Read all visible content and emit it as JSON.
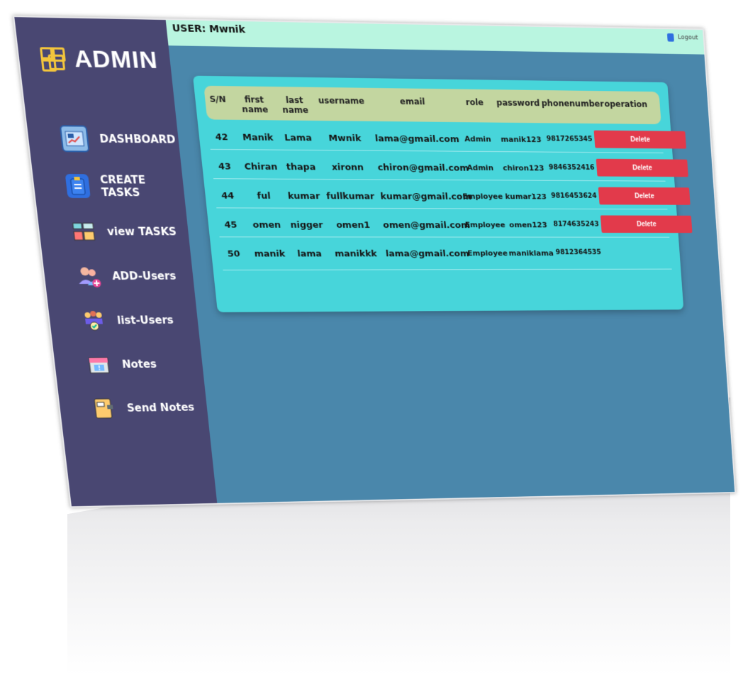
{
  "brand": {
    "title": "ADMIN",
    "accent": "#f3c53c"
  },
  "sidebar": {
    "items": [
      {
        "label": "DASHBOARD",
        "icon": "dashboard-icon"
      },
      {
        "label": "CREATE TASKS",
        "icon": "clipboard-icon"
      },
      {
        "label": "view TASKS",
        "icon": "task-list-icon"
      },
      {
        "label": "ADD-Users",
        "icon": "add-user-icon"
      },
      {
        "label": "list-Users",
        "icon": "users-group-icon"
      },
      {
        "label": "Notes",
        "icon": "calendar-icon"
      },
      {
        "label": "Send Notes",
        "icon": "notebook-icon"
      }
    ]
  },
  "topbar": {
    "user_label": "USER: Mwnik",
    "logout_label": "Logout"
  },
  "table": {
    "columns": [
      "S/N",
      "first name",
      "last name",
      "username",
      "email",
      "role",
      "password",
      "phonenumber",
      "operation"
    ],
    "delete_label": "Delete",
    "rows": [
      {
        "sn": "42",
        "first": "Manik",
        "last": "Lama",
        "username": "Mwnik",
        "email": "lama@gmail.com",
        "role": "Admin",
        "password": "manik123",
        "phone": "9817265345"
      },
      {
        "sn": "43",
        "first": "Chiran",
        "last": "thapa",
        "username": "xironn",
        "email": "chiron@gmail.com",
        "role": "Admin",
        "password": "chiron123",
        "phone": "9846352416"
      },
      {
        "sn": "44",
        "first": "ful",
        "last": "kumar",
        "username": "fullkumar",
        "email": "kumar@gmail.com",
        "role": "Employee",
        "password": "kumar123",
        "phone": "9816453624"
      },
      {
        "sn": "45",
        "first": "omen",
        "last": "nigger",
        "username": "omen1",
        "email": "omen@gmail.com",
        "role": "Employee",
        "password": "omen123",
        "phone": "8174635243"
      },
      {
        "sn": "50",
        "first": "manik",
        "last": "lama",
        "username": "manikkk",
        "email": "lama@gmail.com",
        "role": "Employee",
        "password": "maniklama",
        "phone": "9812364535"
      }
    ]
  },
  "colors": {
    "sidebar": "#494772",
    "topbar": "#b9f5e0",
    "main": "#4a87ab",
    "card": "#47d5da",
    "header": "#c3d6a0",
    "delete": "#e23a4b"
  }
}
